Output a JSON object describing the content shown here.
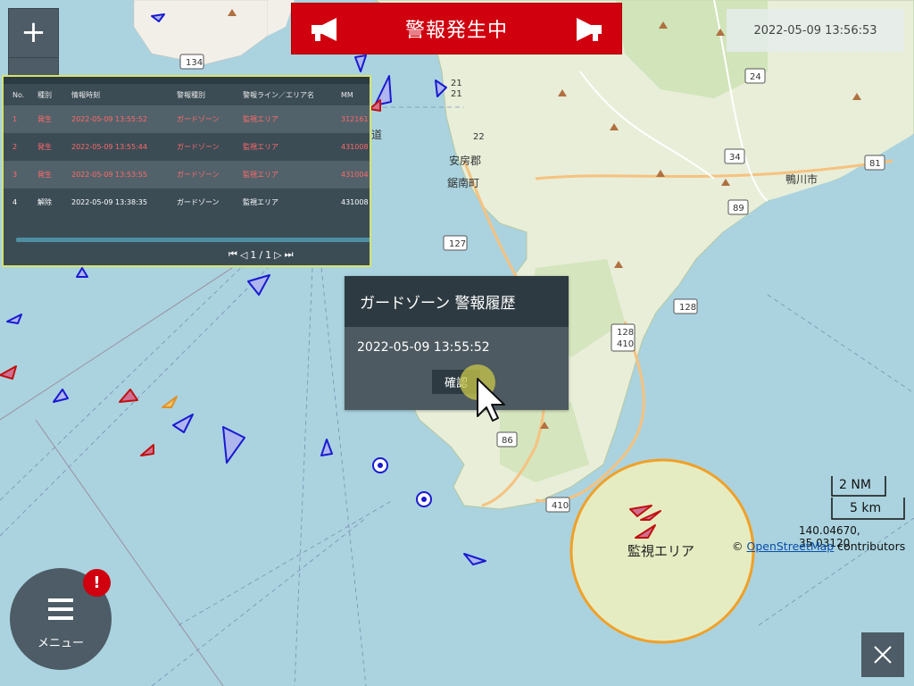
{
  "banner": {
    "text": "警報発生中"
  },
  "datetime": "2022-05-09 13:56:53",
  "zoom": {
    "in_label": "+"
  },
  "history_table": {
    "headers": [
      "No.",
      "種別",
      "情報時刻",
      "警報種別",
      "警報ライン／エリア名",
      "MM"
    ],
    "rows": [
      {
        "no": "1",
        "type": "発生",
        "time": "2022-05-09 13:55:52",
        "alarm": "ガードゾーン",
        "area": "監視エリア",
        "mmsi": "312161"
      },
      {
        "no": "2",
        "type": "発生",
        "time": "2022-05-09 13:55:44",
        "alarm": "ガードゾーン",
        "area": "監視エリア",
        "mmsi": "431008"
      },
      {
        "no": "3",
        "type": "発生",
        "time": "2022-05-09 13:53:55",
        "alarm": "ガードゾーン",
        "area": "監視エリア",
        "mmsi": "431004"
      },
      {
        "no": "4",
        "type": "解除",
        "time": "2022-05-09 13:38:35",
        "alarm": "ガードゾーン",
        "area": "監視エリア",
        "mmsi": "431008"
      }
    ],
    "pager": {
      "current": "1",
      "sep": "/",
      "total": "1"
    }
  },
  "popup": {
    "title": "ガードゾーン 警報履歴",
    "time": "2022-05-09 13:55:52",
    "confirm_label": "確認"
  },
  "menu": {
    "label": "メニュー",
    "badge": "!"
  },
  "scale": {
    "nm": "2 NM",
    "km": "5 km"
  },
  "coords": "140.04670, 35.03120",
  "attribution": {
    "prefix": "© ",
    "link": "OpenStreetMap",
    "suffix": " contributors"
  },
  "zone": {
    "label": "監視エリア"
  },
  "map_labels": {
    "town1": "安房郡",
    "town2": "鋸南町",
    "city": "鴨川市",
    "road_134": "134",
    "road_127": "127",
    "road_128a": "128",
    "road_128b": "128",
    "road_410a": "410",
    "road_410b": "410",
    "road_34": "34",
    "road_89": "89",
    "road_81": "81",
    "road_24": "24",
    "road_86": "86",
    "road_21a": "21",
    "road_21b": "21",
    "road_22": "22",
    "kokudo": "道"
  }
}
